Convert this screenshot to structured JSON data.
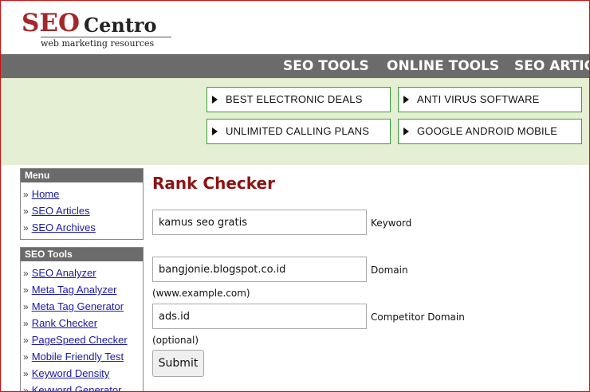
{
  "logo": {
    "brand_seo": "SEO",
    "brand_centro": "Centro",
    "tagline": "web marketing resources"
  },
  "nav": {
    "items": [
      "SEO TOOLS",
      "ONLINE TOOLS",
      "SEO ARTICLES"
    ]
  },
  "ads": {
    "items": [
      "BEST ELECTRONIC DEALS",
      "ANTI VIRUS SOFTWARE",
      "UNLIMITED CALLING PLANS",
      "GOOGLE ANDROID MOBILE"
    ]
  },
  "sidebar": {
    "menu": {
      "title": "Menu",
      "items": [
        "Home",
        "SEO Articles",
        "SEO Archives"
      ]
    },
    "tools": {
      "title": "SEO Tools",
      "items": [
        "SEO Analyzer",
        "Meta Tag Analyzer",
        "Meta Tag Generator",
        "Rank Checker",
        "PageSpeed Checker",
        "Mobile Friendly Test",
        "Keyword Density",
        "Keyword Generator"
      ]
    }
  },
  "main": {
    "title": "Rank Checker",
    "keyword": {
      "value": "kamus seo gratis",
      "label": "Keyword"
    },
    "domain": {
      "value": "bangjonie.blogspot.co.id",
      "label": "Domain",
      "hint": "(www.example.com)"
    },
    "competitor": {
      "value": "ads.id",
      "label": "Competitor Domain",
      "hint": "(optional)"
    },
    "submit_label": "Submit"
  }
}
